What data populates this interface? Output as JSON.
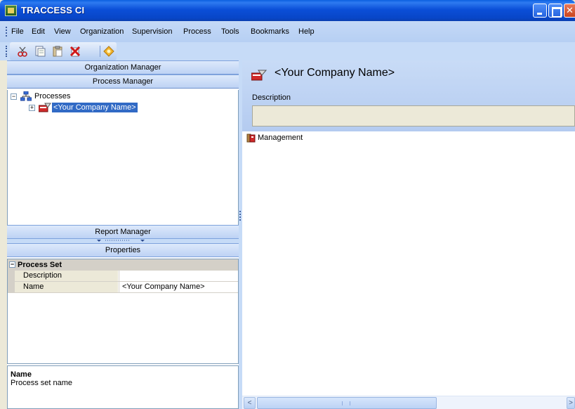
{
  "window": {
    "title": "TRACCESS CI"
  },
  "menu": [
    "File",
    "Edit",
    "View",
    "Organization",
    "Supervision",
    "Process",
    "Tools",
    "Bookmarks",
    "Help"
  ],
  "toolbar": {
    "buttons": [
      "cut-icon",
      "copy-icon",
      "paste-icon",
      "delete-icon",
      "properties-icon"
    ]
  },
  "left_panel": {
    "organization_manager": "Organization Manager",
    "process_manager": "Process Manager",
    "tree": {
      "root": "Processes",
      "child": "<Your Company Name>"
    },
    "report_manager": "Report Manager",
    "properties": "Properties",
    "property_grid": {
      "category": "Process Set",
      "rows": [
        {
          "name": "Description",
          "value": ""
        },
        {
          "name": "Name",
          "value": "<Your Company Name>"
        }
      ]
    },
    "help": {
      "title": "Name",
      "description": "Process set name"
    }
  },
  "right_panel": {
    "title": "<Your Company Name>",
    "description_label": "Description",
    "description_value": "",
    "items": [
      "Management"
    ]
  },
  "colors": {
    "titlebar": "#0b4fd8",
    "header_blue": "#bdd2f4",
    "selection": "#316ac5",
    "description_field": "#ece9d8"
  }
}
